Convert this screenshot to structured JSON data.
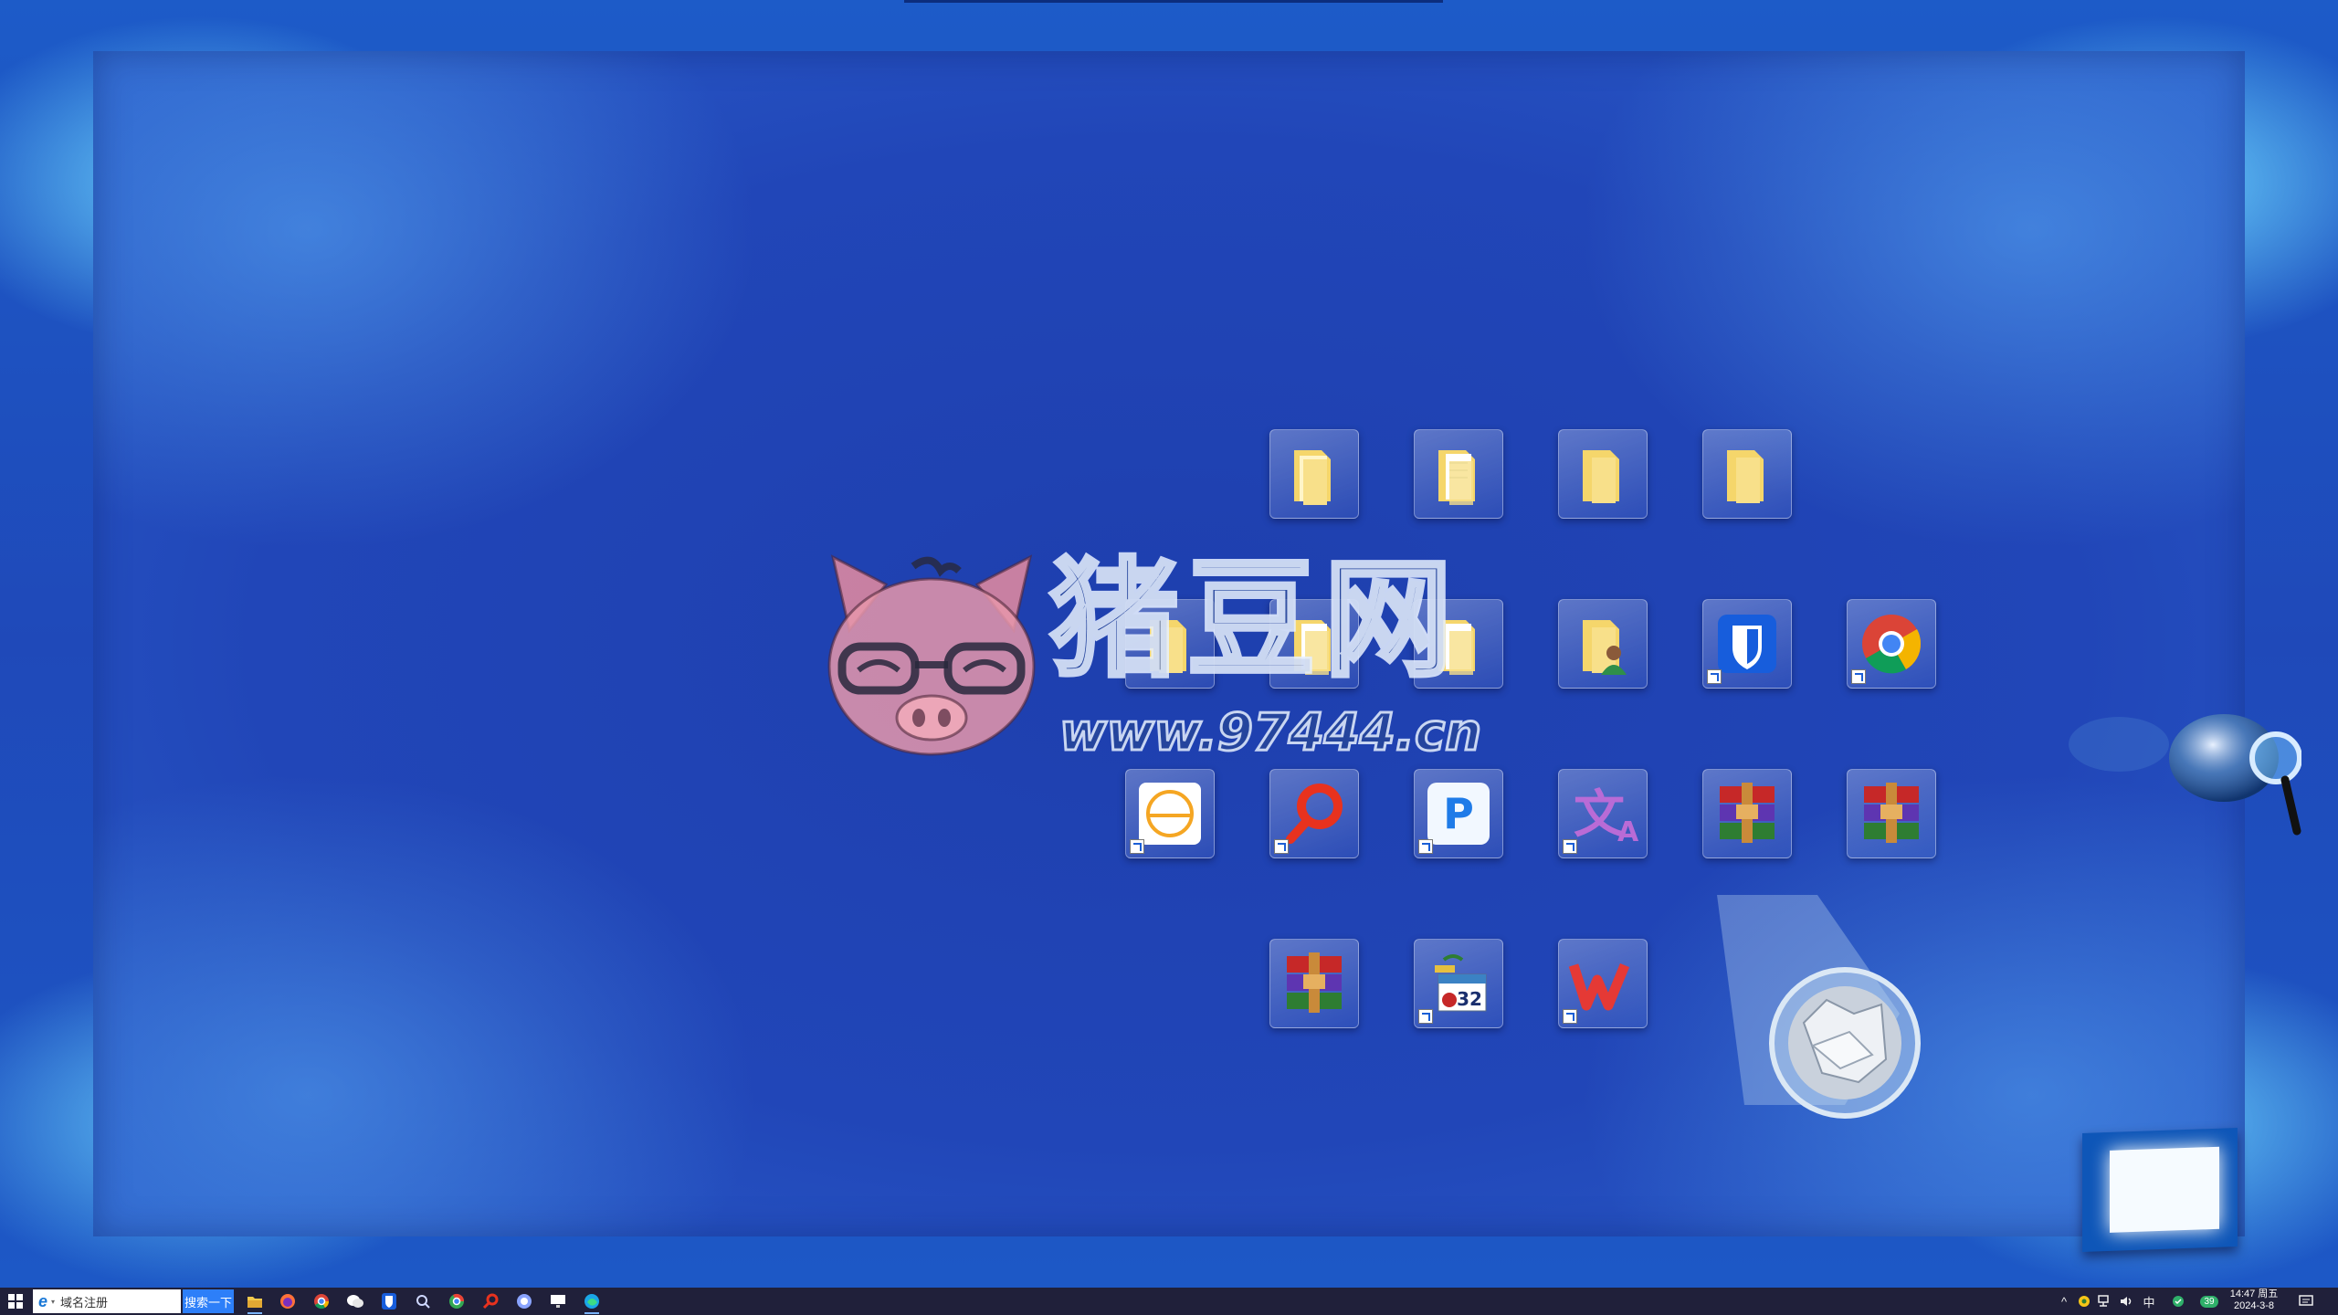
{
  "watermark": {
    "title": "猪豆网",
    "url": "www.97444.cn"
  },
  "desktop": {
    "icons": [
      {
        "name": "folder-icon"
      },
      {
        "name": "document-folder-icon"
      },
      {
        "name": "folder-icon"
      },
      {
        "name": "folder-icon"
      },
      {
        "name": "folder-icon"
      },
      {
        "name": "document-folder-icon"
      },
      {
        "name": "user-folder-icon"
      },
      {
        "name": "bitwarden-icon"
      },
      {
        "name": "chrome-icon"
      },
      {
        "name": "circle-app-icon"
      },
      {
        "name": "search-app-icon"
      },
      {
        "name": "p-app-icon"
      },
      {
        "name": "translate-icon"
      },
      {
        "name": "winrar-icon"
      },
      {
        "name": "winrar-icon"
      },
      {
        "name": "winrar-icon"
      },
      {
        "name": "calendar-icon"
      },
      {
        "name": "wps-office-icon"
      }
    ]
  },
  "taskbar": {
    "search_placeholder": "域名注册",
    "search_button": "搜索一下",
    "apps": [
      "file-explorer-icon",
      "firefox-icon",
      "chrome-icon",
      "wechat-icon",
      "bitwarden-icon",
      "search-icon",
      "chrome-alt-icon",
      "search-app-icon",
      "browser-icon",
      "monitor-icon",
      "edge-icon"
    ],
    "tray": {
      "ime": "中",
      "badge": "39"
    },
    "clock": {
      "time": "14:47 周五",
      "date": "2024-3-8"
    }
  },
  "colors": {
    "accent": "#2d7ff9",
    "taskbar": "#20203a"
  }
}
